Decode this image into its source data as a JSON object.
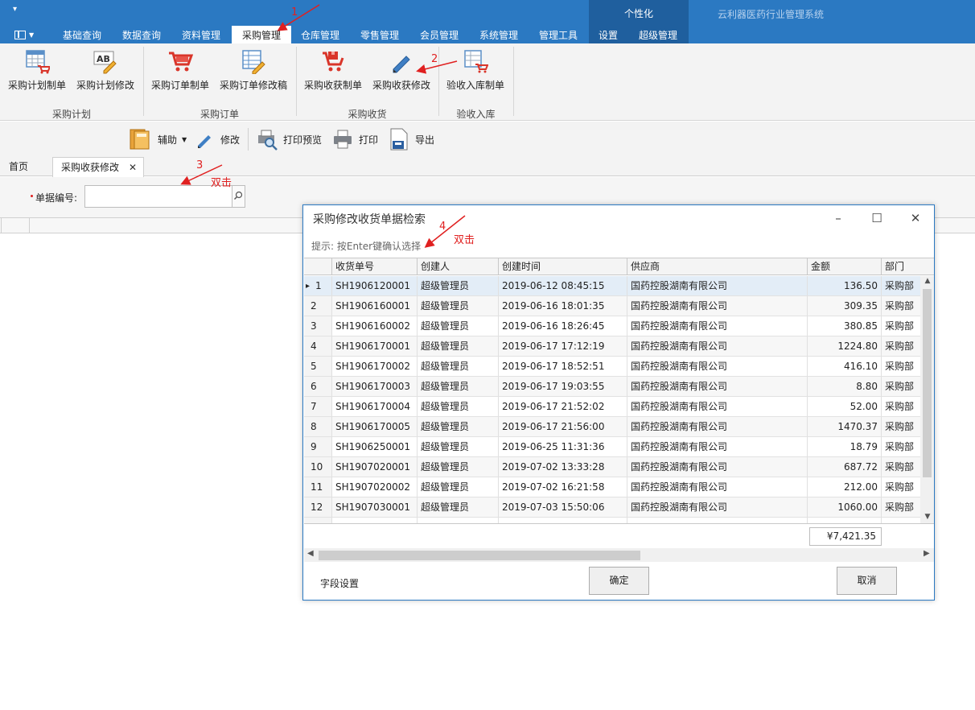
{
  "header": {
    "quick_access": "▾",
    "context_group_title": "个性化",
    "app_title": "云利器医药行业管理系统",
    "tabs": [
      {
        "label": "基础查询"
      },
      {
        "label": "数据查询"
      },
      {
        "label": "资料管理"
      },
      {
        "label": "采购管理"
      },
      {
        "label": "仓库管理"
      },
      {
        "label": "零售管理"
      },
      {
        "label": "会员管理"
      },
      {
        "label": "系统管理"
      },
      {
        "label": "管理工具"
      },
      {
        "label": "设置"
      },
      {
        "label": "超级管理"
      }
    ]
  },
  "ribbon": {
    "buttons": [
      {
        "label": "采购计划制单",
        "icon": "calendar-cart-icon"
      },
      {
        "label": "采购计划修改",
        "icon": "ab-pencil-icon"
      },
      {
        "label": "采购订单制单",
        "icon": "cart-icon"
      },
      {
        "label": "采购订单修改稿",
        "icon": "grid-pencil-icon"
      },
      {
        "label": "采购收获制单",
        "icon": "cart-box-icon"
      },
      {
        "label": "采购收获修改",
        "icon": "pencil-icon"
      },
      {
        "label": "验收入库制单",
        "icon": "calendar-cart-icon"
      }
    ],
    "groups": [
      {
        "label": "采购计划"
      },
      {
        "label": "采购订单"
      },
      {
        "label": "采购收货"
      },
      {
        "label": "验收入库"
      }
    ]
  },
  "toolbar": {
    "assist": "辅助",
    "edit": "修改",
    "print_preview": "打印预览",
    "print": "打印",
    "export": "导出"
  },
  "doc_tabs": {
    "home": "首页",
    "current": "采购收获修改",
    "close": "✕"
  },
  "search": {
    "label": "单据编号:",
    "value": ""
  },
  "dialog": {
    "title": "采购修改收货单据检索",
    "hint": "提示: 按Enter键确认选择",
    "columns": [
      "收货单号",
      "创建人",
      "创建时间",
      "供应商",
      "金额",
      "部门"
    ],
    "rows": [
      {
        "idx": "1",
        "no": "SH1906120001",
        "creator": "超级管理员",
        "time": "2019-06-12 08:45:15",
        "supplier": "国药控股湖南有限公司",
        "amount": "136.50",
        "dept": "采购部"
      },
      {
        "idx": "2",
        "no": "SH1906160001",
        "creator": "超级管理员",
        "time": "2019-06-16 18:01:35",
        "supplier": "国药控股湖南有限公司",
        "amount": "309.35",
        "dept": "采购部"
      },
      {
        "idx": "3",
        "no": "SH1906160002",
        "creator": "超级管理员",
        "time": "2019-06-16 18:26:45",
        "supplier": "国药控股湖南有限公司",
        "amount": "380.85",
        "dept": "采购部"
      },
      {
        "idx": "4",
        "no": "SH1906170001",
        "creator": "超级管理员",
        "time": "2019-06-17 17:12:19",
        "supplier": "国药控股湖南有限公司",
        "amount": "1224.80",
        "dept": "采购部"
      },
      {
        "idx": "5",
        "no": "SH1906170002",
        "creator": "超级管理员",
        "time": "2019-06-17 18:52:51",
        "supplier": "国药控股湖南有限公司",
        "amount": "416.10",
        "dept": "采购部"
      },
      {
        "idx": "6",
        "no": "SH1906170003",
        "creator": "超级管理员",
        "time": "2019-06-17 19:03:55",
        "supplier": "国药控股湖南有限公司",
        "amount": "8.80",
        "dept": "采购部"
      },
      {
        "idx": "7",
        "no": "SH1906170004",
        "creator": "超级管理员",
        "time": "2019-06-17 21:52:02",
        "supplier": "国药控股湖南有限公司",
        "amount": "52.00",
        "dept": "采购部"
      },
      {
        "idx": "8",
        "no": "SH1906170005",
        "creator": "超级管理员",
        "time": "2019-06-17 21:56:00",
        "supplier": "国药控股湖南有限公司",
        "amount": "1470.37",
        "dept": "采购部"
      },
      {
        "idx": "9",
        "no": "SH1906250001",
        "creator": "超级管理员",
        "time": "2019-06-25 11:31:36",
        "supplier": "国药控股湖南有限公司",
        "amount": "18.79",
        "dept": "采购部"
      },
      {
        "idx": "10",
        "no": "SH1907020001",
        "creator": "超级管理员",
        "time": "2019-07-02 13:33:28",
        "supplier": "国药控股湖南有限公司",
        "amount": "687.72",
        "dept": "采购部"
      },
      {
        "idx": "11",
        "no": "SH1907020002",
        "creator": "超级管理员",
        "time": "2019-07-02 16:21:58",
        "supplier": "国药控股湖南有限公司",
        "amount": "212.00",
        "dept": "采购部"
      },
      {
        "idx": "12",
        "no": "SH1907030001",
        "creator": "超级管理员",
        "time": "2019-07-03 15:50:06",
        "supplier": "国药控股湖南有限公司",
        "amount": "1060.00",
        "dept": "采购部"
      }
    ],
    "total": "¥7,421.35",
    "field_settings": "字段设置",
    "ok": "确定",
    "cancel": "取消"
  },
  "annotations": {
    "step1": "1",
    "step2": "2",
    "step3": "3",
    "step4": "4",
    "dblclick": "双击"
  },
  "colors": {
    "brand_blue": "#2b79c2",
    "annotation_red": "#e02020"
  }
}
